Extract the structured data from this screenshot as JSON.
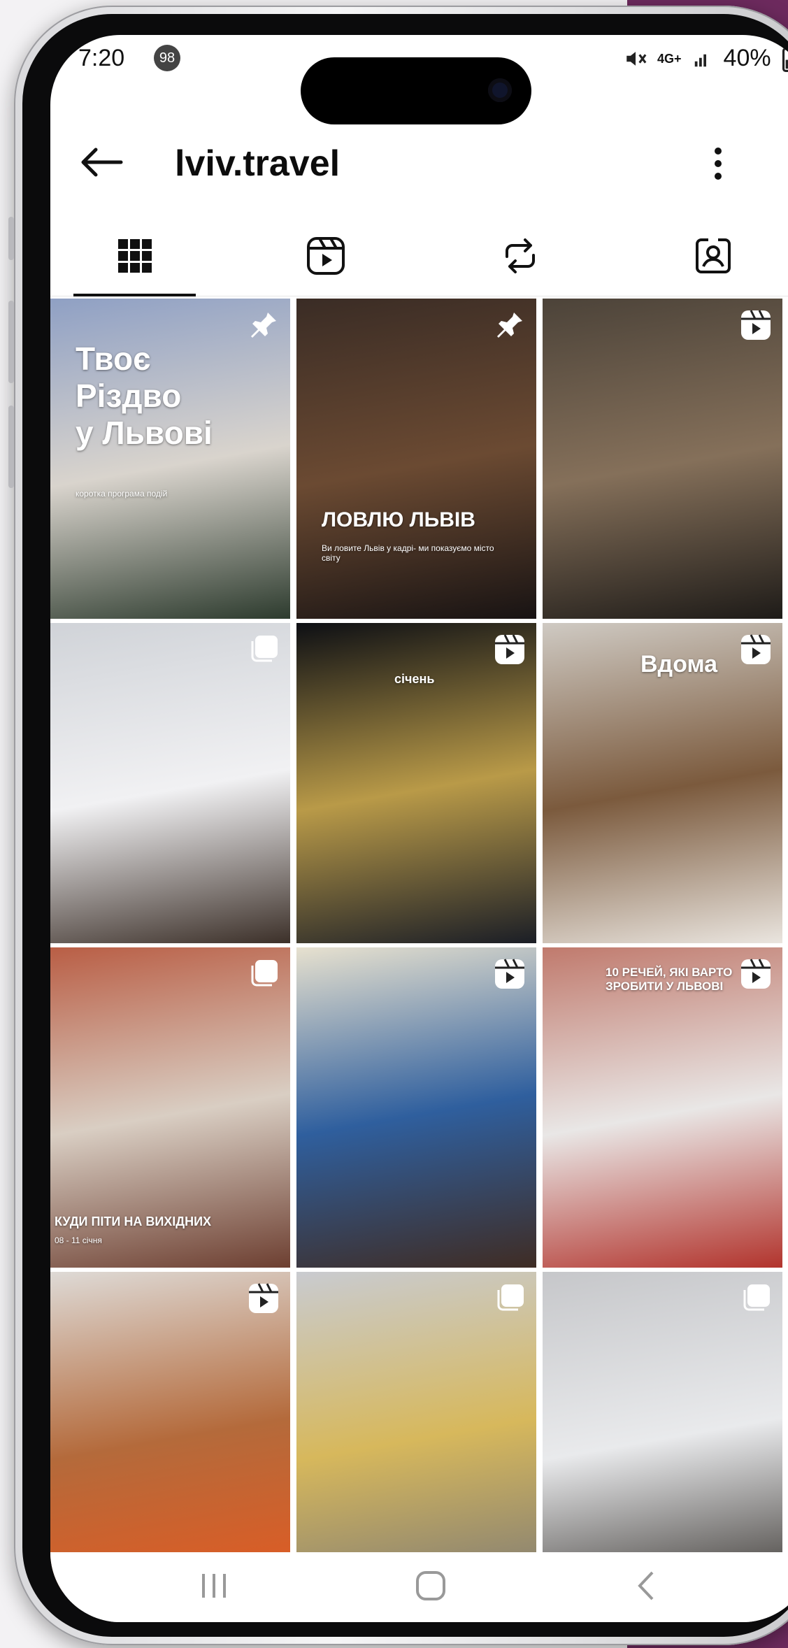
{
  "status_bar": {
    "time": "7:20",
    "notification_count": "98",
    "network": "4G+",
    "battery": "40%"
  },
  "header": {
    "account": "lviv.travel"
  },
  "tabs": [
    {
      "name": "posts",
      "icon": "grid-icon",
      "active": true
    },
    {
      "name": "reels",
      "icon": "reels-icon",
      "active": false
    },
    {
      "name": "reposts",
      "icon": "repost-icon",
      "active": false
    },
    {
      "name": "tagged",
      "icon": "tagged-icon",
      "active": false
    }
  ],
  "posts": [
    {
      "type": "pinned",
      "icon": "pin-icon",
      "title_lines": [
        "Твоє",
        "Різдво",
        "у Львові"
      ],
      "caption": "коротка програма подій",
      "colors": [
        "#8fa0c4",
        "#d9d4cd",
        "#2d3b2e"
      ]
    },
    {
      "type": "pinned",
      "icon": "pin-icon",
      "title_lines": [
        "ЛОВЛЮ ЛЬВІВ"
      ],
      "caption": "Ви ловите Львів у кадрі- ми показуємо місто світу",
      "colors": [
        "#3a2c25",
        "#6b4a32",
        "#181313"
      ]
    },
    {
      "type": "reel",
      "icon": "reel-icon",
      "title_lines": [],
      "caption": "",
      "colors": [
        "#4c4339",
        "#85705a",
        "#1e1b18"
      ]
    },
    {
      "type": "carousel",
      "icon": "carousel-icon",
      "title_lines": [],
      "caption": "",
      "colors": [
        "#d0d3d8",
        "#f1f1f3",
        "#3c3029"
      ]
    },
    {
      "type": "reel",
      "icon": "reel-icon",
      "title_lines": [
        "січень"
      ],
      "caption": "",
      "colors": [
        "#0d0f14",
        "#b99a48",
        "#1b1e26"
      ]
    },
    {
      "type": "reel",
      "icon": "reel-icon",
      "title_lines": [
        "Вдома"
      ],
      "caption": "",
      "colors": [
        "#cfcac3",
        "#7b5a3d",
        "#eae5df"
      ]
    },
    {
      "type": "carousel",
      "icon": "carousel-icon",
      "title_lines": [
        "КУДИ ПІТИ НА ВИХІДНИХ"
      ],
      "caption": "08 - 11 січня",
      "colors": [
        "#b95e45",
        "#d9cec3",
        "#6d3f31"
      ]
    },
    {
      "type": "reel",
      "icon": "reel-icon",
      "title_lines": [],
      "caption": "",
      "colors": [
        "#e7e1cf",
        "#2f5f9e",
        "#3f2c24"
      ]
    },
    {
      "type": "reel",
      "icon": "reel-icon",
      "title_lines": [
        "10 РЕЧЕЙ, ЯКІ ВАРТО",
        "ЗРОБИТИ У ЛЬВОВІ"
      ],
      "caption": "",
      "colors": [
        "#c07a6d",
        "#e9e7e6",
        "#b2342d"
      ]
    },
    {
      "type": "reel",
      "icon": "reel-icon",
      "title_lines": [],
      "caption": "",
      "colors": [
        "#dedad6",
        "#b46a3b",
        "#e35a21"
      ]
    },
    {
      "type": "carousel",
      "icon": "carousel-icon",
      "title_lines": [],
      "caption": "",
      "colors": [
        "#c9cbd0",
        "#d7b85c",
        "#7f7b75"
      ]
    },
    {
      "type": "carousel",
      "icon": "carousel-icon",
      "title_lines": [],
      "caption": "",
      "colors": [
        "#c6c7ca",
        "#e9eaec",
        "#3e3a36"
      ]
    }
  ],
  "nav": [
    "recents",
    "home",
    "back"
  ],
  "colors": {
    "accent": "#6d2a5e",
    "text": "#0c0c0c"
  }
}
